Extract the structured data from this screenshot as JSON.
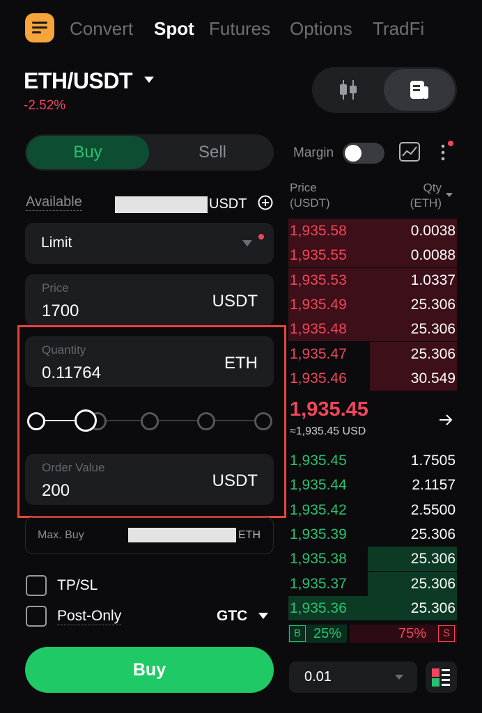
{
  "nav": {
    "tabs": [
      "Convert",
      "Spot",
      "Futures",
      "Options",
      "TradFi"
    ],
    "active": "Spot"
  },
  "pair": {
    "symbol": "ETH/USDT",
    "change": "-2.52%"
  },
  "side_toggle": {
    "buy": "Buy",
    "sell": "Sell",
    "selected": "Buy"
  },
  "margin": {
    "label": "Margin",
    "enabled": false
  },
  "available": {
    "label": "Available",
    "unit": "USDT"
  },
  "order_type": {
    "selected": "Limit"
  },
  "price_field": {
    "label": "Price",
    "value": "1700",
    "unit": "USDT"
  },
  "quantity_field": {
    "label": "Quantity",
    "value": "0.11764",
    "unit": "ETH"
  },
  "slider": {
    "percent": 10
  },
  "order_value_field": {
    "label": "Order Value",
    "value": "200",
    "unit": "USDT"
  },
  "max_buy": {
    "label": "Max. Buy",
    "unit": "ETH"
  },
  "tpsl": {
    "label": "TP/SL",
    "checked": false
  },
  "post_only": {
    "label": "Post-Only",
    "checked": false
  },
  "time_in_force": {
    "selected": "GTC"
  },
  "buy_button": {
    "label": "Buy"
  },
  "orderbook": {
    "price_header": "Price",
    "price_unit": "(USDT)",
    "qty_header": "Qty",
    "qty_unit": "(ETH)",
    "asks": [
      {
        "price": "1,935.58",
        "qty": "0.0038"
      },
      {
        "price": "1,935.55",
        "qty": "0.0088"
      },
      {
        "price": "1,935.53",
        "qty": "1.0337"
      },
      {
        "price": "1,935.49",
        "qty": "25.306"
      },
      {
        "price": "1,935.48",
        "qty": "25.306"
      },
      {
        "price": "1,935.47",
        "qty": "25.306"
      },
      {
        "price": "1,935.46",
        "qty": "30.549"
      }
    ],
    "mid_price": "1,935.45",
    "mid_usd": "≈1,935.45 USD",
    "bids": [
      {
        "price": "1,935.45",
        "qty": "1.7505"
      },
      {
        "price": "1,935.44",
        "qty": "2.1157"
      },
      {
        "price": "1,935.42",
        "qty": "2.5500"
      },
      {
        "price": "1,935.39",
        "qty": "25.306"
      },
      {
        "price": "1,935.38",
        "qty": "25.306"
      },
      {
        "price": "1,935.37",
        "qty": "25.306"
      },
      {
        "price": "1,935.36",
        "qty": "25.306"
      }
    ],
    "buy_ratio": {
      "badge": "B",
      "value": "25%"
    },
    "sell_ratio": {
      "badge": "S",
      "value": "75%"
    },
    "precision": "0.01"
  },
  "colors": {
    "up": "#28c26f",
    "down": "#f0465c",
    "accent": "#f7a43a",
    "highlight": "#e8433b"
  }
}
